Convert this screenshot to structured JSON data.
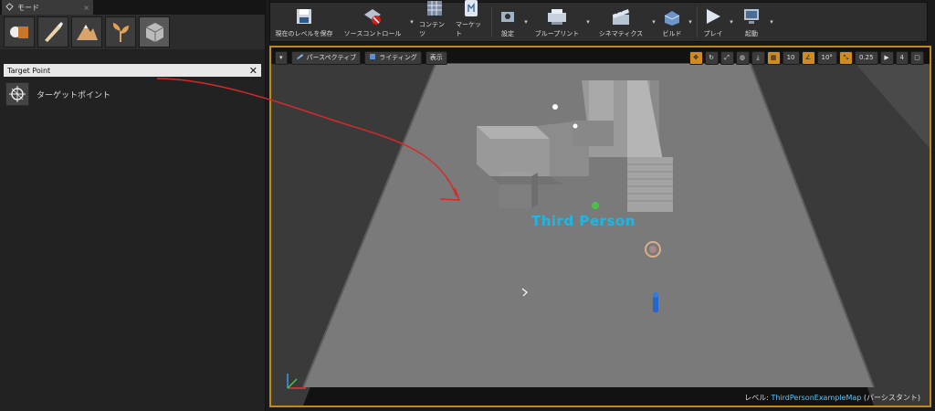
{
  "modes_panel": {
    "tab_label": "モード",
    "tab_close": "×",
    "mode_buttons": [
      {
        "icon": "place-mode-icon"
      },
      {
        "icon": "paint-mode-icon"
      },
      {
        "icon": "landscape-mode-icon"
      },
      {
        "icon": "foliage-mode-icon"
      },
      {
        "icon": "geometry-mode-icon"
      }
    ],
    "search": {
      "value": "Target Point",
      "clear": "✕"
    },
    "results": [
      {
        "label": "ターゲットポイント",
        "icon": "target-point-icon"
      }
    ]
  },
  "toolbar": {
    "buttons": [
      {
        "label": "現在のレベルを保存",
        "icon": "save-icon",
        "dropdown": false
      },
      {
        "label": "ソースコントロール",
        "icon": "source-control-icon",
        "dropdown": true
      },
      {
        "label": "コンテンツ",
        "icon": "content-icon",
        "dropdown": false
      },
      {
        "label": "マーケット",
        "icon": "marketplace-icon",
        "dropdown": false
      },
      {
        "label": "設定",
        "icon": "settings-icon",
        "dropdown": true
      },
      {
        "label": "ブループリント",
        "icon": "blueprint-icon",
        "dropdown": true
      },
      {
        "label": "シネマティクス",
        "icon": "cinematics-icon",
        "dropdown": true
      },
      {
        "label": "ビルド",
        "icon": "build-icon",
        "dropdown": true
      },
      {
        "label": "プレイ",
        "icon": "play-icon",
        "dropdown": true
      },
      {
        "label": "起動",
        "icon": "launch-icon",
        "dropdown": true
      }
    ],
    "dropdown_glyph": "▾"
  },
  "viewport": {
    "menu_glyph": "▾",
    "perspective_label": "パースペクティブ",
    "lighting_label": "ライティング",
    "show_label": "表示",
    "grid_snap": "10",
    "rotation_snap": "10°",
    "scale_snap": "0.25",
    "camera_speed": "4",
    "level_prefix": "レベル:",
    "level_name": "ThirdPersonExampleMap",
    "level_suffix": "(パーシスタント)",
    "scene_text": "Third Person",
    "accent_color": "#c08a17"
  }
}
